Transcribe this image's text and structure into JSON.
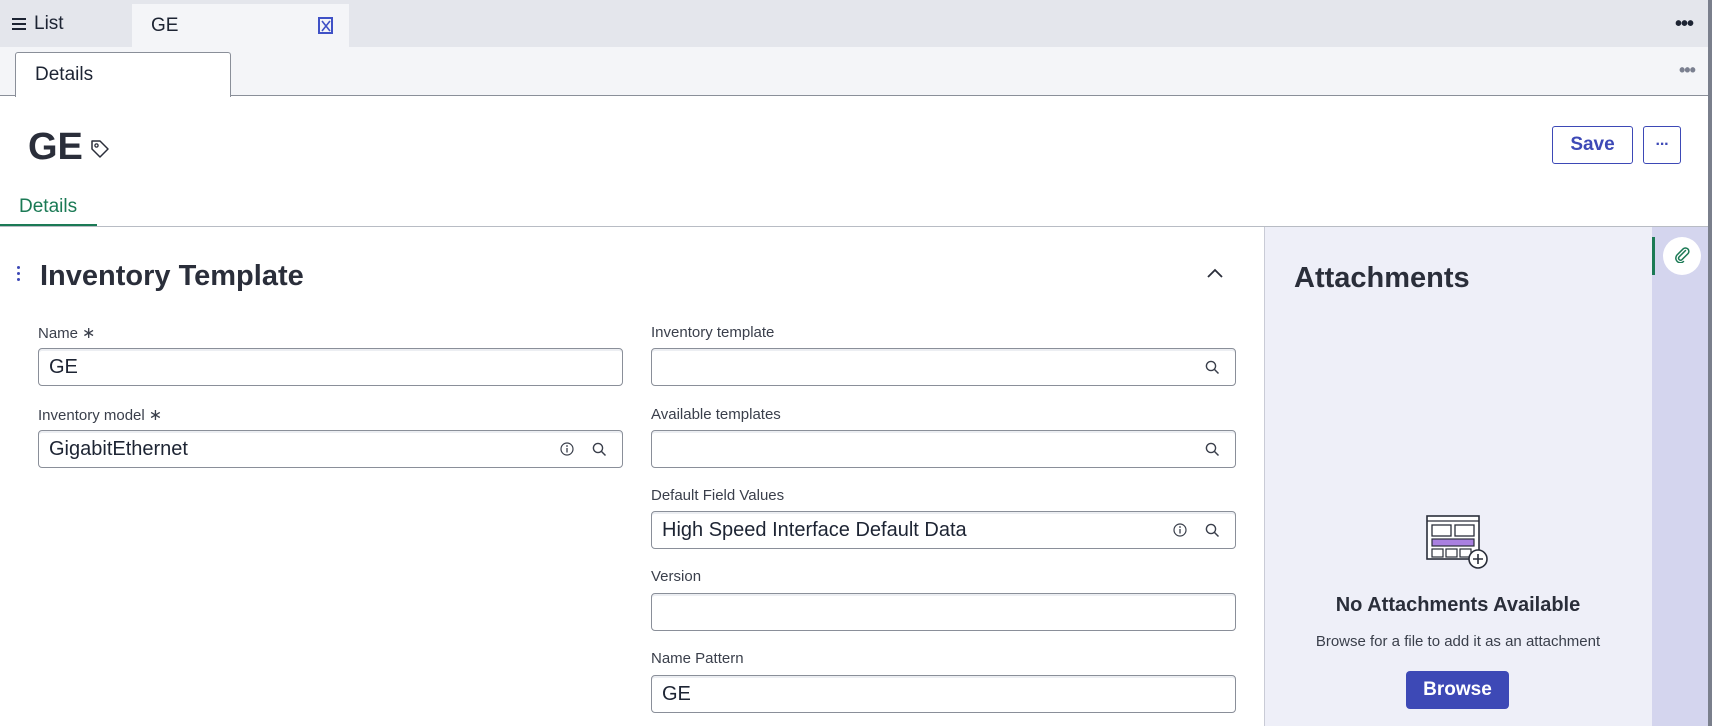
{
  "tabs": {
    "list_label": "List",
    "record_label": "GE"
  },
  "subtabs": {
    "details_label": "Details"
  },
  "header": {
    "title": "GE",
    "save_label": "Save",
    "more_label": "···",
    "tab_details": "Details"
  },
  "section": {
    "title": "Inventory Template",
    "fields": {
      "name": {
        "label": "Name",
        "required": "∗",
        "value": "GE"
      },
      "inventory_model": {
        "label": "Inventory model",
        "required": "∗",
        "value": "GigabitEthernet"
      },
      "inventory_template": {
        "label": "Inventory template",
        "value": ""
      },
      "available_templates": {
        "label": "Available templates",
        "value": ""
      },
      "default_field_values": {
        "label": "Default Field Values",
        "value": "High Speed Interface Default Data"
      },
      "version": {
        "label": "Version",
        "value": ""
      },
      "name_pattern": {
        "label": "Name Pattern",
        "value": "GE"
      }
    }
  },
  "attachments": {
    "title": "Attachments",
    "empty_title": "No Attachments Available",
    "empty_hint": "Browse for a file to add it as an attachment",
    "browse_label": "Browse"
  },
  "colors": {
    "accent": "#3d49b6",
    "active_tab": "#1b7a55",
    "tab_strip": "#e4e6ec",
    "attach_panel": "#eeeff8",
    "side_rail": "#d4d5ee"
  }
}
